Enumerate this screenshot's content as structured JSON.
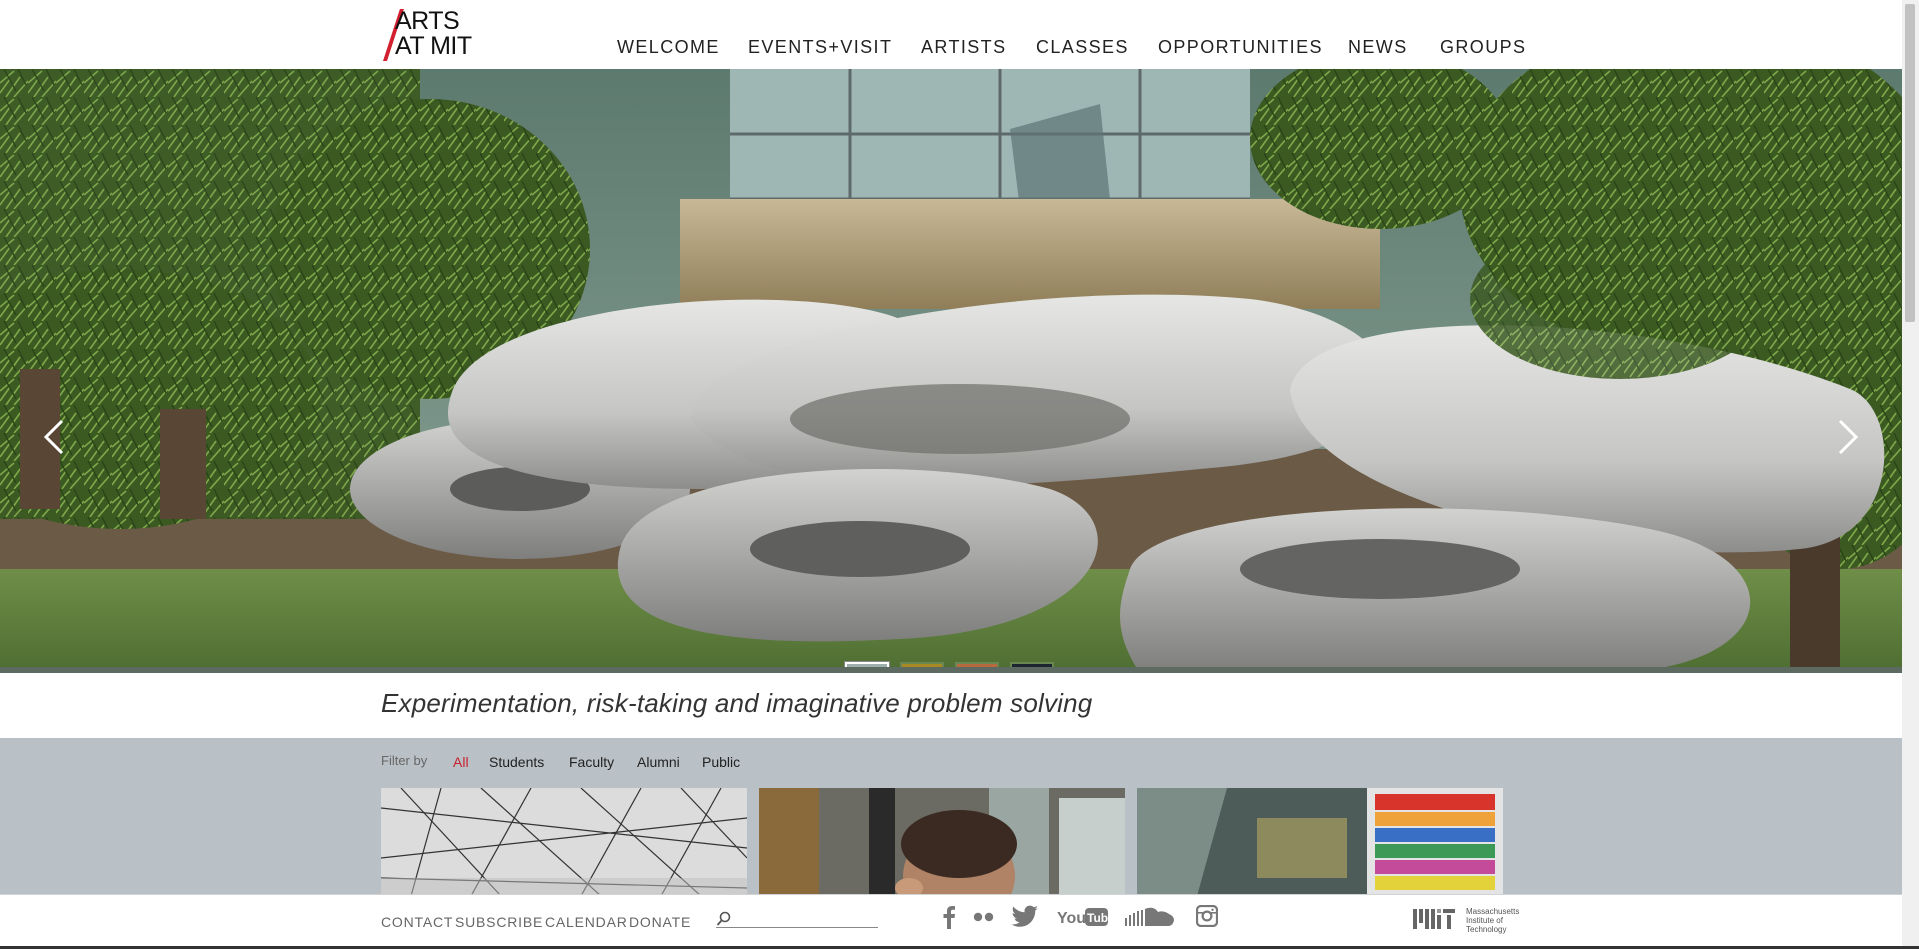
{
  "logo": {
    "line1": "ARTS",
    "line2": "AT MIT",
    "accent": "#d22030"
  },
  "nav": {
    "items": [
      {
        "label": "WELCOME"
      },
      {
        "label": "EVENTS+VISIT"
      },
      {
        "label": "ARTISTS"
      },
      {
        "label": "CLASSES"
      },
      {
        "label": "OPPORTUNITIES"
      },
      {
        "label": "NEWS"
      },
      {
        "label": "GROUPS"
      }
    ]
  },
  "hero": {
    "prev_icon": "chevron-left-icon",
    "next_icon": "chevron-right-icon",
    "thumbnails": [
      "sculpture",
      "gold-artwork",
      "orange-room",
      "dark-screen"
    ],
    "active_thumbnail": 0
  },
  "tagline": "Experimentation, risk-taking and imaginative problem solving",
  "filter": {
    "label": "Filter by",
    "options": [
      "All",
      "Students",
      "Faculty",
      "Alumni",
      "Public"
    ],
    "active": "All",
    "active_color": "#c8202e"
  },
  "footer": {
    "links": [
      "CONTACT",
      "SUBSCRIBE",
      "CALENDAR",
      "DONATE"
    ],
    "search_icon": "search-icon",
    "social": [
      "facebook-icon",
      "flickr-icon",
      "twitter-icon",
      "youtube-icon",
      "soundcloud-icon",
      "instagram-icon"
    ],
    "mit_lines": [
      "Massachusetts",
      "Institute of",
      "Technology"
    ]
  }
}
